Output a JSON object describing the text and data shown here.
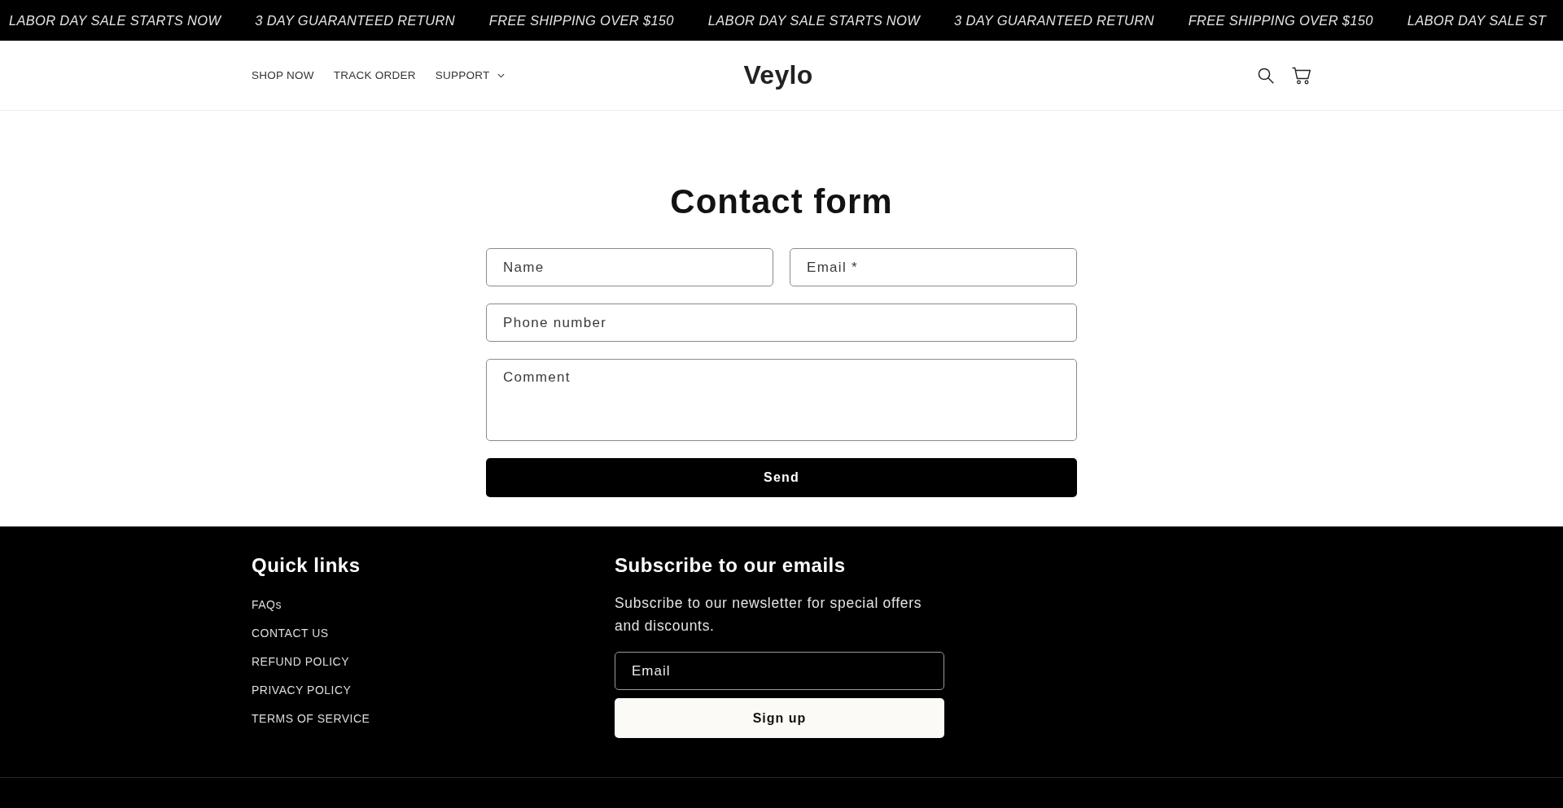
{
  "announcement_bar": {
    "messages": [
      "LABOR DAY SALE STARTS NOW",
      "3 DAY GUARANTEED RETURN",
      "FREE SHIPPING OVER $150",
      "LABOR DAY SALE STARTS NOW",
      "3 DAY GUARANTEED RETURN",
      "FREE SHIPPING OVER $150",
      "LABOR DAY SALE ST"
    ]
  },
  "header": {
    "nav": [
      {
        "label": "SHOP NOW",
        "kind": "link"
      },
      {
        "label": "TRACK ORDER",
        "kind": "link"
      },
      {
        "label": "SUPPORT",
        "kind": "dropdown"
      }
    ],
    "logo": "Veylo"
  },
  "contact_form": {
    "title": "Contact form",
    "rows": [
      [
        {
          "placeholder": "Name",
          "kind": "input"
        },
        {
          "placeholder": "Email *",
          "kind": "input"
        }
      ],
      [
        {
          "placeholder": "Phone number",
          "kind": "input"
        }
      ],
      [
        {
          "placeholder": "Comment",
          "kind": "textarea"
        }
      ]
    ],
    "submit": "Send"
  },
  "footer": {
    "quick_links": {
      "title": "Quick links",
      "items": [
        "FAQs",
        "CONTACT US",
        "REFUND POLICY",
        "PRIVACY POLICY",
        "TERMS OF SERVICE"
      ]
    },
    "newsletter": {
      "title": "Subscribe to our emails",
      "text": "Subscribe to our newsletter for special offers and discounts.",
      "email_placeholder": "Email",
      "button": "Sign up"
    }
  }
}
